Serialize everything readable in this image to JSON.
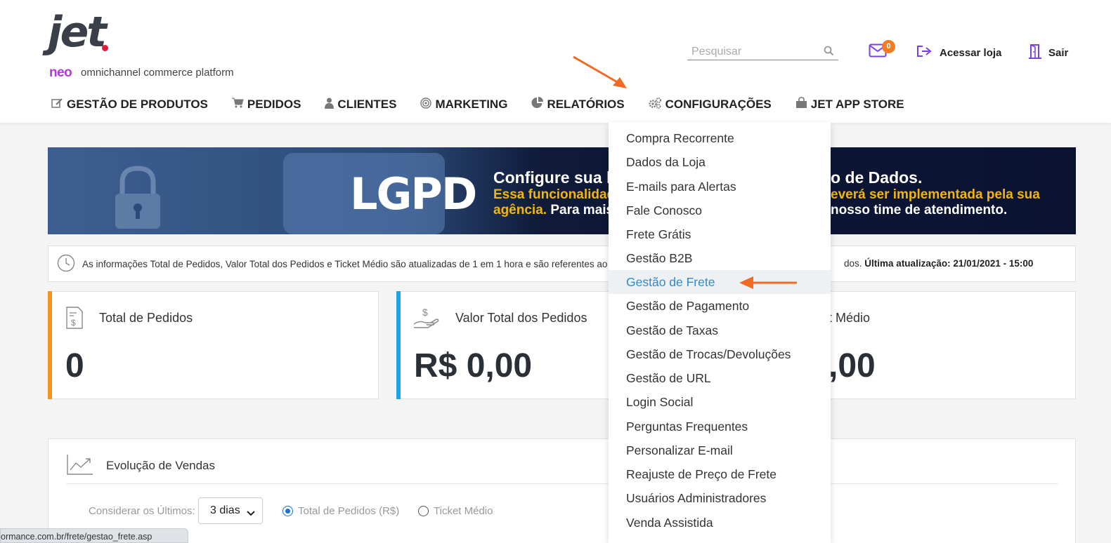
{
  "brand": {
    "name": "jet",
    "sub_brand": "neo",
    "tagline": "omnichannel commerce platform"
  },
  "header": {
    "search_placeholder": "Pesquisar",
    "mail_count": "0",
    "store_link": "Acessar loja",
    "logout": "Sair"
  },
  "nav": [
    {
      "label": "GESTÃO DE PRODUTOS",
      "icon": "edit-icon"
    },
    {
      "label": "PEDIDOS",
      "icon": "cart-icon"
    },
    {
      "label": "CLIENTES",
      "icon": "user-icon"
    },
    {
      "label": "MARKETING",
      "icon": "target-icon"
    },
    {
      "label": "RELATÓRIOS",
      "icon": "pie-chart-icon"
    },
    {
      "label": "CONFIGURAÇÕES",
      "icon": "gears-icon"
    },
    {
      "label": "JET APP STORE",
      "icon": "shopping-bag-icon"
    }
  ],
  "banner": {
    "title_left": "LGPD",
    "line1_left": "Configure sua lo",
    "line1_right": "o de Dados.",
    "line2_left": "Essa funcionalidad",
    "line2_right": "everá ser implementada pela sua",
    "line3_left_highlight": "agência.",
    "line3_left": " Para mais",
    "line3_right": "nosso time de atendimento."
  },
  "info_bar": {
    "text": "As informações Total de Pedidos, Valor Total dos Pedidos e Ticket Médio são atualizadas de 1 em 1 hora e são referentes ao",
    "tail_suffix": "dos.",
    "last_update_label": "Última atualização: 21/01/2021 - 15:00"
  },
  "cards": [
    {
      "title": "Total de Pedidos",
      "value": "0",
      "accent": "#f7941d"
    },
    {
      "title": "Valor Total dos Pedidos",
      "value": "R$ 0,00",
      "accent": "#1aa7e6"
    },
    {
      "title": "t Médio",
      "value": ",00"
    }
  ],
  "sales_panel": {
    "title": "Evolução de Vendas",
    "consider_label": "Considerar os Últimos:",
    "period_value": "3 dias",
    "radio_total": "Total de Pedidos (R$)",
    "radio_ticket": "Ticket Médio"
  },
  "status_url": "ormance.com.br/frete/gestao_frete.asp",
  "config_menu": {
    "items": [
      "Compra Recorrente",
      "Dados da Loja",
      "E-mails para Alertas",
      "Fale Conosco",
      "Frete Grátis",
      "Gestão B2B",
      "Gestão de Frete",
      "Gestão de Pagamento",
      "Gestão de Taxas",
      "Gestão de Trocas/Devoluções",
      "Gestão de URL",
      "Login Social",
      "Perguntas Frequentes",
      "Personalizar E-mail",
      "Reajuste de Preço de Frete",
      "Usuários Administradores",
      "Venda Assistida"
    ],
    "active": "Gestão de Frete"
  },
  "colors": {
    "accent_orange": "#f26a21",
    "active_link": "#2c8dc9",
    "brand_purple": "#b23bd6"
  }
}
